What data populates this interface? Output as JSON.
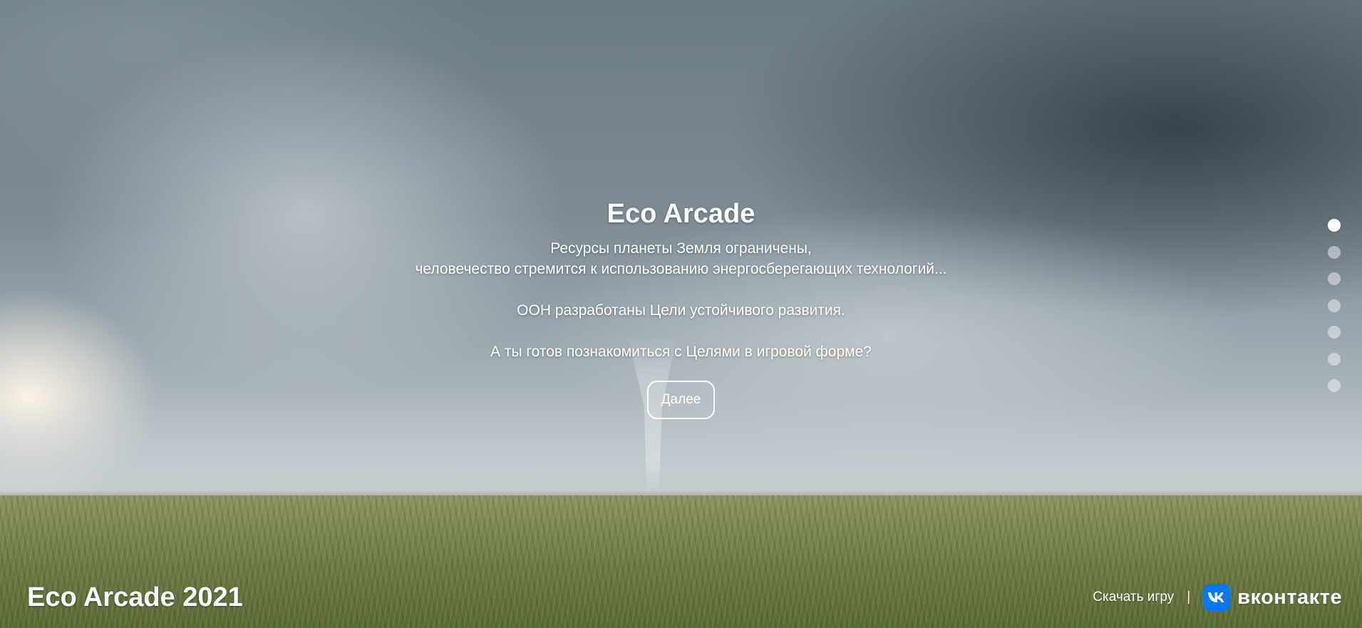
{
  "hero": {
    "title": "Eco Arcade",
    "line1": "Ресурсы планеты Земля ограничены,",
    "line2": "человечество стремится к использованию энергосберегающих технологий...",
    "line3": "ООН разработаны Цели устойчивого развития.",
    "line4": "А ты готов познакомиться с Целями в игровой форме?",
    "next_label": "Далее"
  },
  "pagination": {
    "count": 7,
    "active_index": 0
  },
  "footer": {
    "brand": "Eco Arcade 2021",
    "download_label": "Скачать игру",
    "divider": "|",
    "vk_label": "вконтакте"
  },
  "colors": {
    "vk_blue": "#0077ff",
    "text": "#ffffff"
  },
  "icons": {
    "vk": "vk-logo-icon"
  }
}
